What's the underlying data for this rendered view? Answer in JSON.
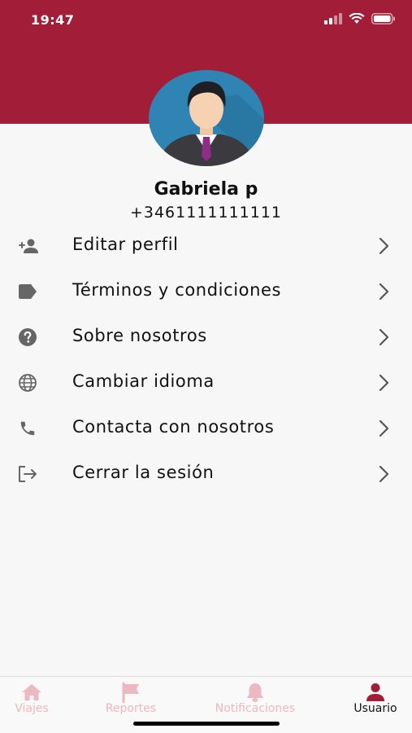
{
  "status_bar": {
    "time": "19:47"
  },
  "profile": {
    "name": "Gabriela p",
    "phone": "+3461111111111"
  },
  "menu": {
    "items": [
      {
        "label": "Editar perfil",
        "icon": "add-user-icon"
      },
      {
        "label": "Términos y condiciones",
        "icon": "label-tag-icon"
      },
      {
        "label": "Sobre nosotros",
        "icon": "help-circle-icon"
      },
      {
        "label": "Cambiar idioma",
        "icon": "globe-icon"
      },
      {
        "label": "Contacta con nosotros",
        "icon": "phone-icon"
      },
      {
        "label": "Cerrar la sesión",
        "icon": "logout-icon"
      }
    ]
  },
  "tabs": [
    {
      "label": "Viajes",
      "icon": "home-icon",
      "active": false
    },
    {
      "label": "Reportes",
      "icon": "flag-icon",
      "active": false
    },
    {
      "label": "Notificaciones",
      "icon": "bell-icon",
      "active": false
    },
    {
      "label": "Usuario",
      "icon": "user-icon",
      "active": true
    }
  ],
  "colors": {
    "brand": "#a11d38",
    "inactive_tab": "#ecb8c1",
    "icon_gray": "#666666"
  }
}
